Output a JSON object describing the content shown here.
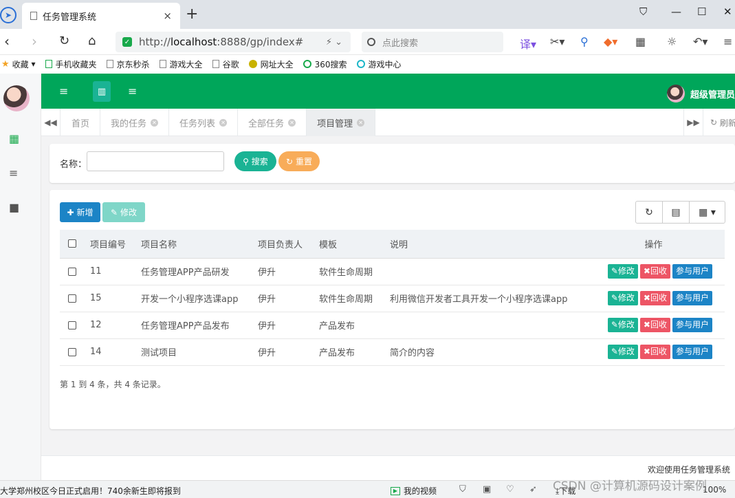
{
  "browser": {
    "tab_title": "任务管理系统",
    "tab_close": "×",
    "new_tab": "+",
    "url_prefix": "http://",
    "url_host": "localhost",
    "url_rest": ":8888/gp/index#",
    "search_placeholder": "点此搜索",
    "bookmarks": [
      "收藏",
      "手机收藏夹",
      "京东秒杀",
      "游戏大全",
      "谷歌",
      "网址大全",
      "360搜索",
      "游戏中心"
    ]
  },
  "app": {
    "user_name": "超级管理员",
    "tabs": [
      {
        "label": "首页",
        "closable": false,
        "active": false
      },
      {
        "label": "我的任务",
        "closable": true,
        "active": false
      },
      {
        "label": "任务列表",
        "closable": true,
        "active": false
      },
      {
        "label": "全部任务",
        "closable": true,
        "active": false
      },
      {
        "label": "项目管理",
        "closable": true,
        "active": true
      }
    ],
    "refresh_label": "刷新",
    "search_form": {
      "name_label": "名称：",
      "name_value": "",
      "search_button": "搜索",
      "reset_button": "重置"
    },
    "toolbar": {
      "add_button": "新增",
      "edit_button": "修改"
    },
    "table": {
      "headers": [
        "项目编号",
        "项目名称",
        "项目负责人",
        "模板",
        "说明",
        "操作"
      ],
      "rows": [
        {
          "id": "11",
          "name": "任务管理APP产品研发",
          "owner": "伊升",
          "template": "软件生命周期",
          "desc": ""
        },
        {
          "id": "15",
          "name": "开发一个小程序选课app",
          "owner": "伊升",
          "template": "软件生命周期",
          "desc": "利用微信开发者工具开发一个小程序选课app"
        },
        {
          "id": "12",
          "name": "任务管理APP产品发布",
          "owner": "伊升",
          "template": "产品发布",
          "desc": ""
        },
        {
          "id": "14",
          "name": "测试项目",
          "owner": "伊升",
          "template": "产品发布",
          "desc": "简介的内容"
        }
      ],
      "row_actions": {
        "edit": "修改",
        "recycle": "回收",
        "users": "参与用户"
      }
    },
    "pagination_info": "第 1 到 4 条，共 4 条记录。",
    "footer_text": "欢迎使用任务管理系统"
  },
  "statusbar": {
    "news": "大学郑州校区今日正式启用！740余新生即将报到",
    "video": "我的视频",
    "download": "下载",
    "zoom": "100%"
  },
  "watermark": "CSDN @计算机源码设计案例",
  "colors": {
    "topbar": "#00a65a",
    "primary": "#1ab394",
    "danger": "#ed5565",
    "info": "#1c84c6",
    "warning": "#f8ac59"
  }
}
